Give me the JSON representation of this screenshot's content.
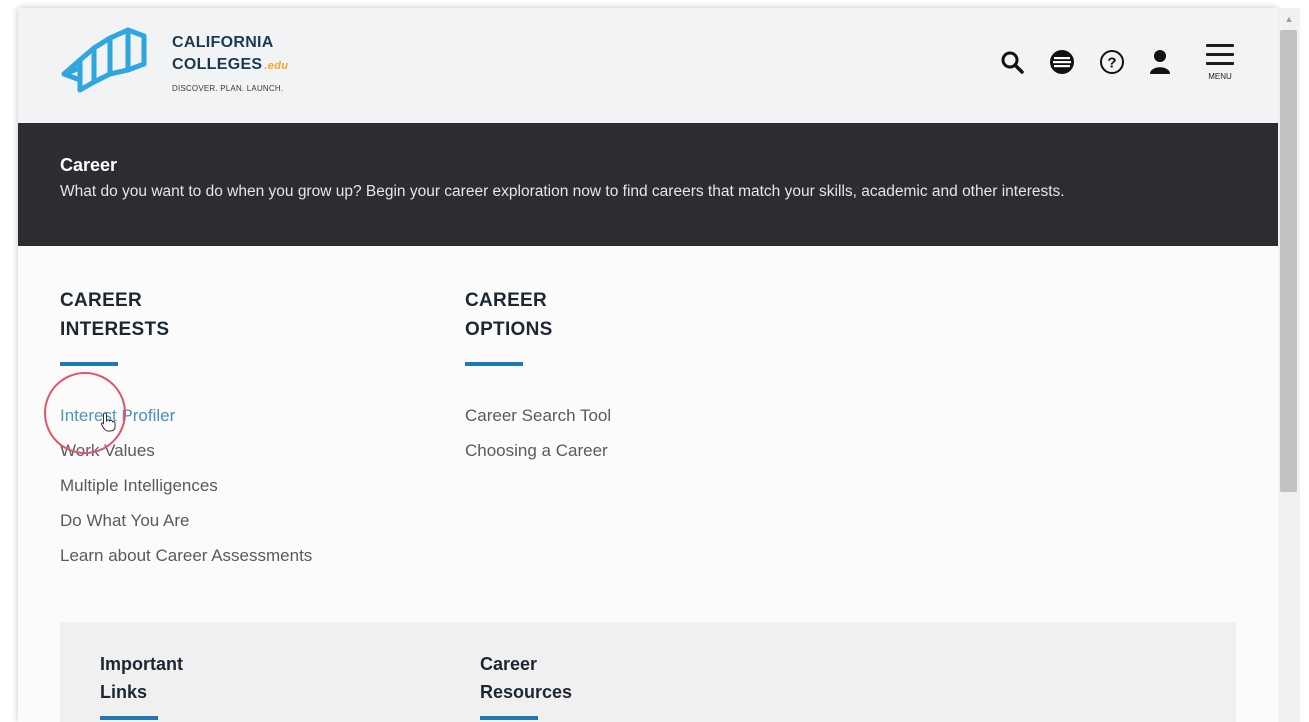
{
  "brand": {
    "name_line1": "CALIFORNIA",
    "name_line2": "COLLEGES",
    "name_suffix": ".edu",
    "tagline": "DISCOVER. PLAN. LAUNCH.",
    "accent_color": "#1f7ab4"
  },
  "header": {
    "icons": [
      "search-icon",
      "globe-icon",
      "help-icon",
      "user-icon"
    ],
    "menu_label": "MENU"
  },
  "banner": {
    "title": "Career",
    "description": "What do you want to do when you grow up? Begin your career exploration now to find careers that match your skills, academic and other interests."
  },
  "sections": [
    {
      "title_line1": "CAREER",
      "title_line2": "INTERESTS",
      "links": [
        "Interest Profiler",
        "Work Values",
        "Multiple Intelligences",
        "Do What You Are",
        "Learn about Career Assessments"
      ]
    },
    {
      "title_line1": "CAREER",
      "title_line2": "OPTIONS",
      "links": [
        "Career Search Tool",
        "Choosing a Career"
      ]
    }
  ],
  "panel": {
    "sections": [
      {
        "title_line1": "Important",
        "title_line2": "Links"
      },
      {
        "title_line1": "Career",
        "title_line2": "Resources"
      }
    ]
  }
}
